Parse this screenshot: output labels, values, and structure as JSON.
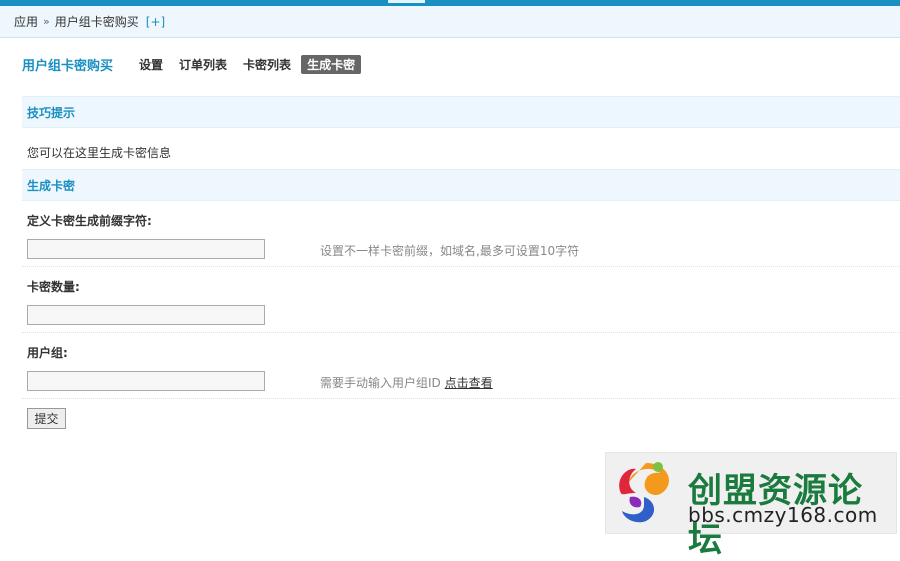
{
  "breadcrumb": {
    "root": "应用",
    "separator": "»",
    "current": "用户组卡密购买",
    "add": "[+]"
  },
  "nav": {
    "title": "用户组卡密购买",
    "tabs": [
      "设置",
      "订单列表",
      "卡密列表",
      "生成卡密"
    ],
    "active_tab": "生成卡密"
  },
  "tips": {
    "header": "技巧提示",
    "text": "您可以在这里生成卡密信息"
  },
  "form": {
    "header": "生成卡密",
    "prefix": {
      "label": "定义卡密生成前缀字符:",
      "value": "",
      "hint": "设置不一样卡密前缀，如域名,最多可设置10字符"
    },
    "count": {
      "label": "卡密数量:",
      "value": ""
    },
    "group": {
      "label": "用户组:",
      "value": "",
      "hint": "需要手动输入用户组ID",
      "link": "点击查看"
    },
    "submit_label": "提交"
  },
  "watermark": {
    "name": "创盟资源论坛",
    "url": "bbs.cmzy168.com"
  },
  "colors": {
    "accent": "#1a8fc2",
    "section_bg": "#eef7fd",
    "active_tab_bg": "#666666"
  }
}
